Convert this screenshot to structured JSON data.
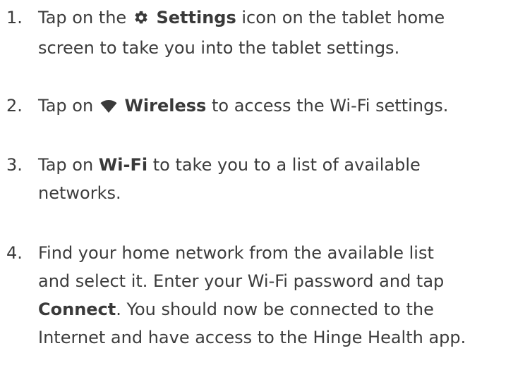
{
  "steps": [
    {
      "number": "1.",
      "line1_pre": "Tap on the",
      "line1_strong": "Settings",
      "line1_post": "icon on the tablet home",
      "line2": "screen to take you into the tablet settings.",
      "icon": "gear-icon"
    },
    {
      "number": "2.",
      "line1_pre": "Tap on",
      "line1_strong": "Wireless",
      "line1_post": "to access the Wi-Fi settings.",
      "icon": "wifi-icon"
    },
    {
      "number": "3.",
      "line1_pre": "Tap on",
      "line1_strong": "Wi-Fi",
      "line1_post": "to take you to a list of available",
      "line2": "networks."
    },
    {
      "number": "4.",
      "line1": "Find your home network from the available list",
      "line2": "and select it. Enter your Wi-Fi password and tap",
      "line3_strong": "Connect",
      "line3_post": ". You should now be connected to the",
      "line4": "Internet and have access to the Hinge Health app."
    }
  ]
}
